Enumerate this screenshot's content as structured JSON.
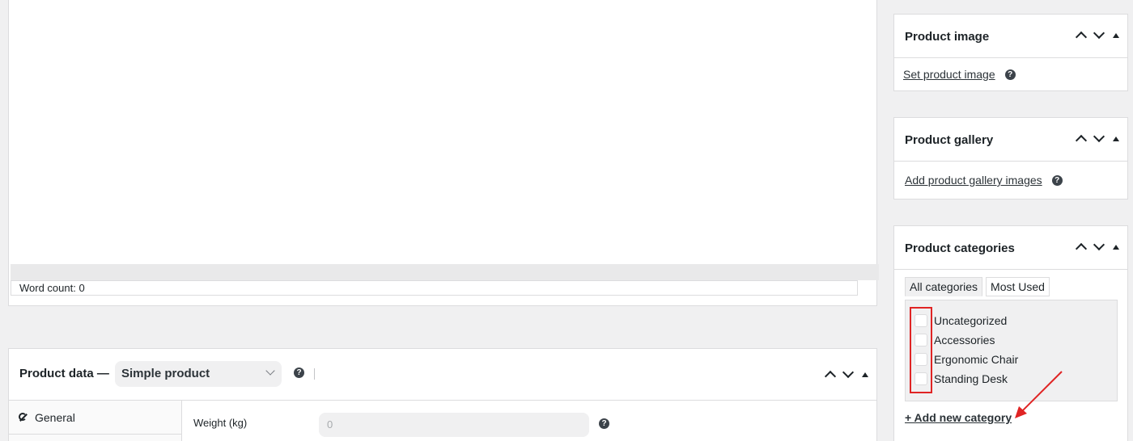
{
  "editor": {
    "word_count": "Word count: 0"
  },
  "product_data": {
    "title": "Product data —",
    "type_selected": "Simple product",
    "help": "?",
    "tabs": [
      {
        "label": "General",
        "icon": "wrench-icon"
      }
    ],
    "weight_label": "Weight (kg)",
    "weight_placeholder": "0"
  },
  "product_image": {
    "title": "Product image",
    "link": "Set product image",
    "help": "?"
  },
  "product_gallery": {
    "title": "Product gallery",
    "link": "Add product gallery images",
    "help": "?"
  },
  "product_categories": {
    "title": "Product categories",
    "tabs": [
      "All categories",
      "Most Used"
    ],
    "items": [
      "Uncategorized",
      "Accessories",
      "Ergonomic Chair",
      "Standing Desk"
    ],
    "add_link": "+ Add new category"
  },
  "colors": {
    "annotation": "#e02424",
    "link": "#2c3338"
  }
}
